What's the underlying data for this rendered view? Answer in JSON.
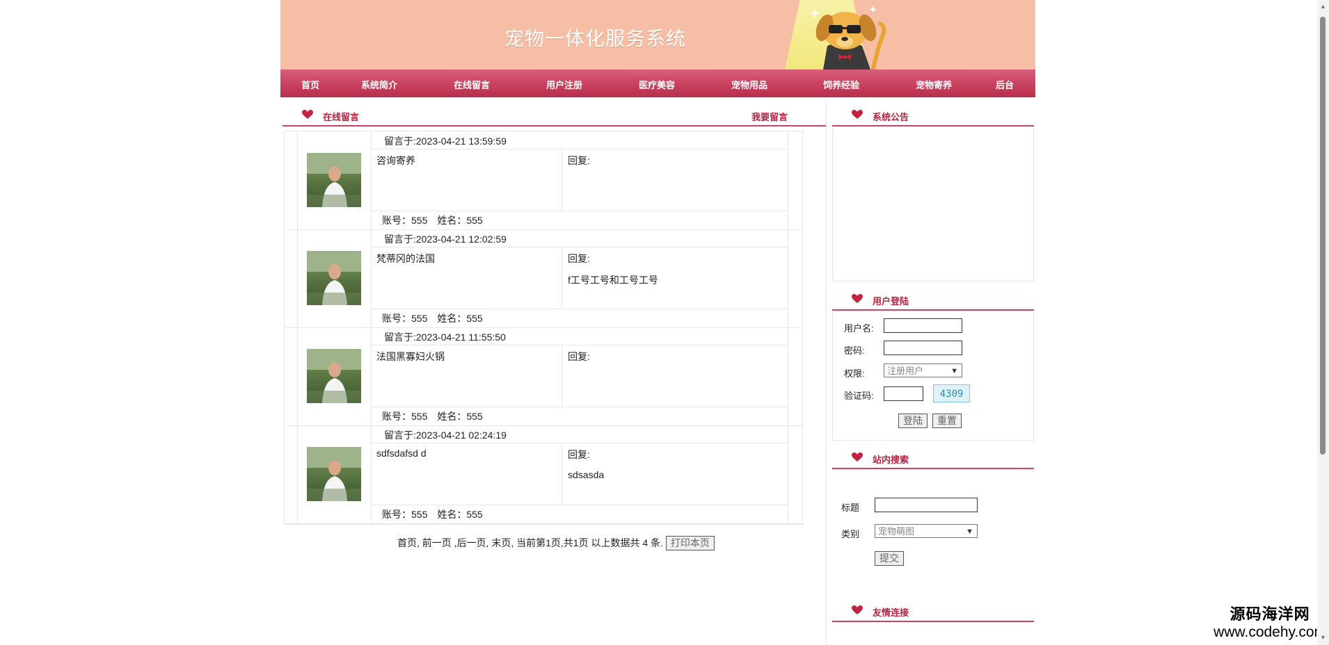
{
  "site_title": "宠物一体化服务系统",
  "nav": [
    "首页",
    "系统简介",
    "在线留言",
    "用户注册",
    "医疗美容",
    "宠物用品",
    "饲养经验",
    "宠物寄养",
    "后台"
  ],
  "guestbook": {
    "title": "在线留言",
    "write_link": "我要留言",
    "reply_label": "回复:",
    "messages": [
      {
        "time": "留言于:2023-04-21 13:59:59",
        "content": "咨询寄养",
        "reply": "",
        "account": "账号：555　姓名：555"
      },
      {
        "time": "留言于:2023-04-21 12:02:59",
        "content": "梵蒂冈的法国",
        "reply": "f工号工号和工号工号",
        "account": "账号：555　姓名：555"
      },
      {
        "time": "留言于:2023-04-21 11:55:50",
        "content": "法国黑寡妇火锅",
        "reply": "",
        "account": "账号：555　姓名：555"
      },
      {
        "time": "留言于:2023-04-21 02:24:19",
        "content": "sdfsdafsd d",
        "reply": "sdsasda",
        "account": "账号：555　姓名：555"
      }
    ],
    "pager_text": "首页, 前一页 ,后一页, 末页, 当前第1页,共1页 以上数据共 4 条.",
    "print_button": "打印本页"
  },
  "sidebar": {
    "notice_title": "系统公告",
    "login": {
      "title": "用户登陆",
      "username_label": "用户名:",
      "password_label": "密码:",
      "role_label": "权限:",
      "role_value": "注册用户",
      "captcha_label": "验证码:",
      "captcha_value": "4309",
      "login_button": "登陆",
      "reset_button": "重置"
    },
    "search": {
      "title": "站内搜索",
      "title_label": "标题",
      "category_label": "类别",
      "category_value": "宠物萌图",
      "submit_button": "提交"
    },
    "links_title": "友情连接"
  },
  "watermark": {
    "line1": "源码海洋网",
    "line2": "www.codehy.com"
  },
  "colors": {
    "banner": "#f7bea6",
    "nav": "#c9415f",
    "accent": "#b4243f"
  }
}
